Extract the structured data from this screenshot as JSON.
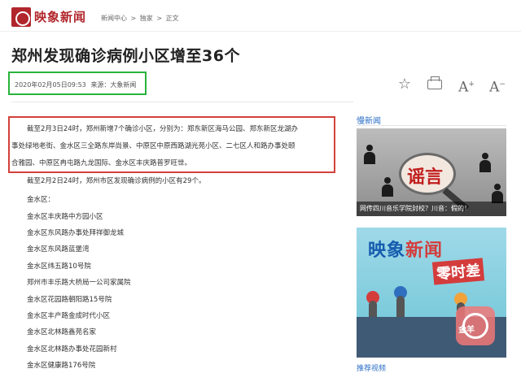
{
  "header": {
    "logo_text": "映象新闻",
    "breadcrumb": [
      "新闻中心",
      ">",
      "独家",
      ">",
      "正文"
    ]
  },
  "article": {
    "title": "郑州发现确诊病例小区增至36个",
    "datetime": "2020年02月05日09:53",
    "source": "来源：大象新闻",
    "highlight_lines": [
      "截至2月3日24时，郑州新增7个确诊小区，分别为：郑东新区海马公园、郑东新区龙湖办",
      "事处绿地老街、金水区三全路东岸尚景、中原区中原西路湖光苑小区、二七区人和路办事处颐",
      "合雅园、中原区冉屯路九龙国际、金水区丰庆路普罗旺世。"
    ],
    "lines": [
      "截至2月2日24时，郑州市区发现确诊病例的小区有29个。",
      "金水区：",
      "金水区丰庆路中方园小区",
      "金水区东风路办事处拜祥御龙城",
      "金水区东风路蓝堡湾",
      "金水区纬五路10号院",
      "郑州市丰乐路大桥局一公司家属院",
      "金水区花园路朝阳路15号院",
      "金水区丰产路金成时代小区",
      "金水区北林路鑫苑名家",
      "金水区北林路办事处花园新村",
      "金水区健康路176号院"
    ]
  },
  "toolbar": {
    "font_up": "A",
    "font_down": "A",
    "font_up_sup": "+",
    "font_down_sup": "−"
  },
  "sidebar": {
    "section_title": "慢新闻",
    "card1_word": "谣言",
    "card1_caption": "网传四川音乐学院封校？川音：假的！",
    "card2_line1a": "映象",
    "card2_line1b": "新闻",
    "card2_line2": "零时差",
    "bottom_title": "推荐视频"
  },
  "watermark_text": "金羊",
  "colors": {
    "brand": "#b1262c",
    "link": "#2a6ec5",
    "meta_box": "#2ab33b",
    "highlight_box": "#d2413a"
  }
}
